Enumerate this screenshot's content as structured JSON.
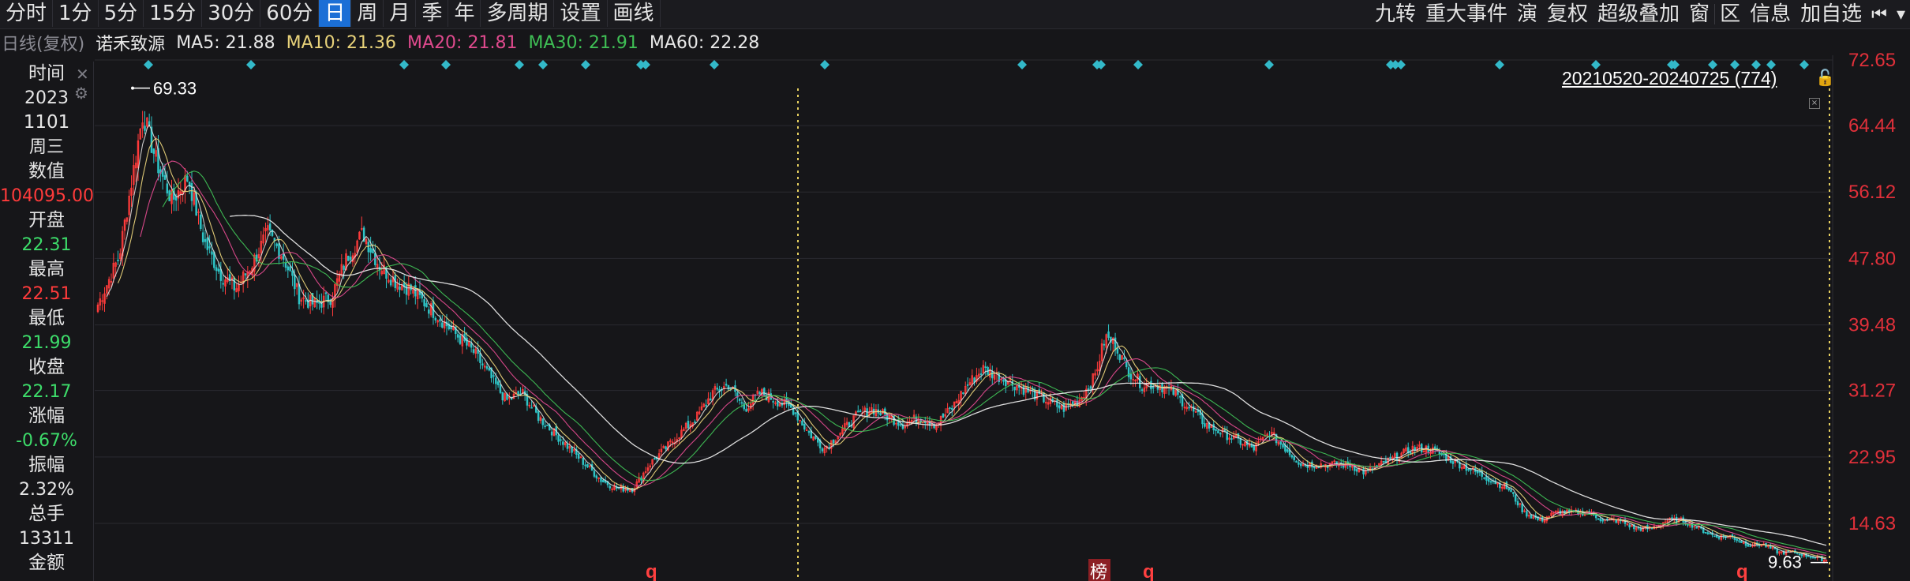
{
  "toolbar": {
    "periods": [
      "分时",
      "1分",
      "5分",
      "15分",
      "30分",
      "60分",
      "日",
      "周",
      "月",
      "季",
      "年",
      "多周期",
      "设置",
      "画线"
    ],
    "active_period": "日",
    "right_items": [
      "九转",
      "重大事件",
      "演",
      "复权",
      "超级叠加",
      "窗",
      "区",
      "信息",
      "加自选"
    ]
  },
  "legend": {
    "period": "日线(复权)",
    "name": "诺禾致源",
    "ma": [
      {
        "label": "MA5: 21.88",
        "color": "#e8e8e8"
      },
      {
        "label": "MA10: 21.36",
        "color": "#e8d27a"
      },
      {
        "label": "MA20: 21.81",
        "color": "#e04a8e"
      },
      {
        "label": "MA30: 21.91",
        "color": "#3fbf55"
      },
      {
        "label": "MA60: 22.28",
        "color": "#e8e8e8"
      }
    ]
  },
  "info_panel": [
    {
      "label": "时间",
      "color": "#e6e6e6"
    },
    {
      "label": "2023",
      "color": "#e6e6e6"
    },
    {
      "label": "1101",
      "color": "#e6e6e6"
    },
    {
      "label": "周三",
      "color": "#e6e6e6"
    },
    {
      "label": "数值",
      "color": "#e6e6e6"
    },
    {
      "label": "104095.00",
      "color": "#ff3b3b"
    },
    {
      "label": "开盘",
      "color": "#e6e6e6"
    },
    {
      "label": "22.31",
      "color": "#3ddc6a"
    },
    {
      "label": "最高",
      "color": "#e6e6e6"
    },
    {
      "label": "22.51",
      "color": "#ff3b3b"
    },
    {
      "label": "最低",
      "color": "#e6e6e6"
    },
    {
      "label": "21.99",
      "color": "#3ddc6a"
    },
    {
      "label": "收盘",
      "color": "#e6e6e6"
    },
    {
      "label": "22.17",
      "color": "#3ddc6a"
    },
    {
      "label": "涨幅",
      "color": "#e6e6e6"
    },
    {
      "label": "-0.67%",
      "color": "#3ddc6a"
    },
    {
      "label": "振幅",
      "color": "#e6e6e6"
    },
    {
      "label": "2.32%",
      "color": "#e6e6e6"
    },
    {
      "label": "总手",
      "color": "#e6e6e6"
    },
    {
      "label": "13311",
      "color": "#e6e6e6"
    },
    {
      "label": "金额",
      "color": "#e6e6e6"
    }
  ],
  "range_label": "20210520-20240725 (774)",
  "markers": {
    "bang": "榜",
    "q": "q"
  },
  "colors": {
    "up": "#ff3b3b",
    "down": "#2ec4c6",
    "axis": "#e0303a",
    "grid": "#2a2a30",
    "highlight": "#e6d060"
  },
  "chart_data": {
    "type": "candlestick",
    "y_axis_ticks": [
      72.65,
      64.44,
      56.12,
      47.8,
      39.48,
      31.27,
      22.95,
      14.63
    ],
    "ylim": [
      9.0,
      72.65
    ],
    "max_label": "69.33",
    "min_label": "9.63",
    "session_count": 774,
    "date_range": "20210520-20240725",
    "close_path_approx": [
      {
        "x": 0,
        "y": 42
      },
      {
        "x": 8,
        "y": 48
      },
      {
        "x": 14,
        "y": 60
      },
      {
        "x": 17,
        "y": 66
      },
      {
        "x": 22,
        "y": 60
      },
      {
        "x": 28,
        "y": 55
      },
      {
        "x": 34,
        "y": 58
      },
      {
        "x": 40,
        "y": 50
      },
      {
        "x": 46,
        "y": 46
      },
      {
        "x": 52,
        "y": 44
      },
      {
        "x": 58,
        "y": 47
      },
      {
        "x": 64,
        "y": 51
      },
      {
        "x": 70,
        "y": 48
      },
      {
        "x": 76,
        "y": 43
      },
      {
        "x": 82,
        "y": 42
      },
      {
        "x": 88,
        "y": 43
      },
      {
        "x": 94,
        "y": 48
      },
      {
        "x": 100,
        "y": 51
      },
      {
        "x": 106,
        "y": 47
      },
      {
        "x": 112,
        "y": 45
      },
      {
        "x": 118,
        "y": 44
      },
      {
        "x": 124,
        "y": 42
      },
      {
        "x": 130,
        "y": 40
      },
      {
        "x": 136,
        "y": 38
      },
      {
        "x": 142,
        "y": 36
      },
      {
        "x": 148,
        "y": 33
      },
      {
        "x": 154,
        "y": 30
      },
      {
        "x": 160,
        "y": 31
      },
      {
        "x": 166,
        "y": 28
      },
      {
        "x": 172,
        "y": 26
      },
      {
        "x": 178,
        "y": 24
      },
      {
        "x": 184,
        "y": 22
      },
      {
        "x": 190,
        "y": 20
      },
      {
        "x": 196,
        "y": 19
      },
      {
        "x": 202,
        "y": 19
      },
      {
        "x": 208,
        "y": 22
      },
      {
        "x": 214,
        "y": 24
      },
      {
        "x": 220,
        "y": 26
      },
      {
        "x": 226,
        "y": 28
      },
      {
        "x": 232,
        "y": 31
      },
      {
        "x": 238,
        "y": 32
      },
      {
        "x": 244,
        "y": 29
      },
      {
        "x": 250,
        "y": 31
      },
      {
        "x": 256,
        "y": 30
      },
      {
        "x": 262,
        "y": 29
      },
      {
        "x": 268,
        "y": 26
      },
      {
        "x": 274,
        "y": 24
      },
      {
        "x": 280,
        "y": 26
      },
      {
        "x": 286,
        "y": 28
      },
      {
        "x": 292,
        "y": 29
      },
      {
        "x": 298,
        "y": 28
      },
      {
        "x": 304,
        "y": 27
      },
      {
        "x": 310,
        "y": 28
      },
      {
        "x": 316,
        "y": 27
      },
      {
        "x": 322,
        "y": 29
      },
      {
        "x": 328,
        "y": 32
      },
      {
        "x": 334,
        "y": 34
      },
      {
        "x": 340,
        "y": 33
      },
      {
        "x": 346,
        "y": 32
      },
      {
        "x": 352,
        "y": 31
      },
      {
        "x": 358,
        "y": 30
      },
      {
        "x": 364,
        "y": 29
      },
      {
        "x": 370,
        "y": 30
      },
      {
        "x": 376,
        "y": 33
      },
      {
        "x": 380,
        "y": 38
      },
      {
        "x": 384,
        "y": 37
      },
      {
        "x": 388,
        "y": 34
      },
      {
        "x": 394,
        "y": 32
      },
      {
        "x": 400,
        "y": 32
      },
      {
        "x": 406,
        "y": 31
      },
      {
        "x": 412,
        "y": 29
      },
      {
        "x": 418,
        "y": 27
      },
      {
        "x": 424,
        "y": 26
      },
      {
        "x": 430,
        "y": 25
      },
      {
        "x": 436,
        "y": 24
      },
      {
        "x": 442,
        "y": 26
      },
      {
        "x": 448,
        "y": 24
      },
      {
        "x": 454,
        "y": 22
      },
      {
        "x": 460,
        "y": 22
      },
      {
        "x": 466,
        "y": 22
      },
      {
        "x": 472,
        "y": 22
      },
      {
        "x": 478,
        "y": 21
      },
      {
        "x": 484,
        "y": 22
      },
      {
        "x": 490,
        "y": 23
      },
      {
        "x": 496,
        "y": 24
      },
      {
        "x": 502,
        "y": 24
      },
      {
        "x": 508,
        "y": 23
      },
      {
        "x": 514,
        "y": 22
      },
      {
        "x": 520,
        "y": 21
      },
      {
        "x": 526,
        "y": 20
      },
      {
        "x": 532,
        "y": 19
      },
      {
        "x": 538,
        "y": 16
      },
      {
        "x": 544,
        "y": 15
      },
      {
        "x": 550,
        "y": 16
      },
      {
        "x": 556,
        "y": 16
      },
      {
        "x": 562,
        "y": 16
      },
      {
        "x": 568,
        "y": 15
      },
      {
        "x": 574,
        "y": 15
      },
      {
        "x": 580,
        "y": 14
      },
      {
        "x": 586,
        "y": 14
      },
      {
        "x": 592,
        "y": 15
      },
      {
        "x": 598,
        "y": 15
      },
      {
        "x": 604,
        "y": 14
      },
      {
        "x": 610,
        "y": 13
      },
      {
        "x": 616,
        "y": 13
      },
      {
        "x": 622,
        "y": 12
      },
      {
        "x": 628,
        "y": 12
      },
      {
        "x": 634,
        "y": 11
      },
      {
        "x": 640,
        "y": 11
      },
      {
        "x": 646,
        "y": 10.5
      },
      {
        "x": 652,
        "y": 10
      }
    ]
  }
}
